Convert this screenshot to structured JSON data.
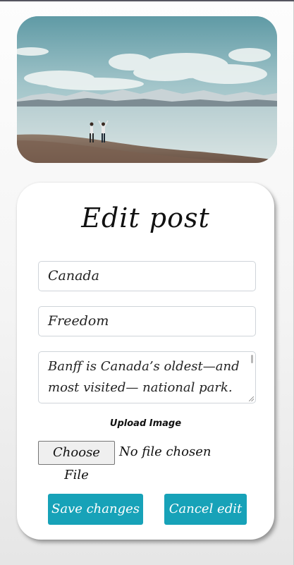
{
  "hero": {
    "image_name": "lake-mountains-photo"
  },
  "form": {
    "title": "Edit post",
    "location_value": "Canada",
    "heading_value": "Freedom",
    "body_value": "Banff is Canada’s oldest—and most visited— national park. Set",
    "upload_label": "Upload Image",
    "file_button_label": "Choose File",
    "file_status": "No file chosen",
    "save_label": "Save changes",
    "cancel_label": "Cancel edit"
  },
  "colors": {
    "accent": "#17a2b8",
    "card": "#ffffff",
    "background": "#f4f4f4"
  }
}
